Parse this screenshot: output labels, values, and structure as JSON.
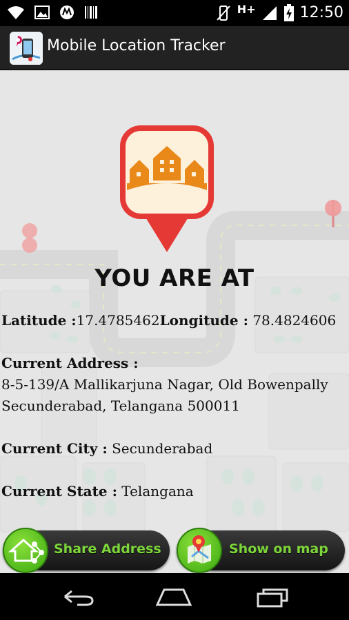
{
  "status_bar": {
    "network_type": "H+",
    "time": "12:50"
  },
  "action_bar": {
    "title": "Mobile Location Tracker"
  },
  "main": {
    "heading": "YOU ARE AT",
    "latitude_label": "Latitude :",
    "latitude_value": "17.4785462",
    "longitude_label": "Longitude :",
    "longitude_value": " 78.4824606",
    "address_label": "Current Address :",
    "address_line1": "8-5-139/A Mallikarjuna Nagar, Old Bowenpally",
    "address_line2": "Secunderabad, Telangana 500011",
    "city_label": "Current City :",
    "city_value": " Secunderabad",
    "state_label": "Current State :",
    "state_value": " Telangana"
  },
  "buttons": {
    "share_address": "Share Address",
    "show_on_map": "Show on map"
  },
  "icons": {
    "location_pin": "house-location-pin-icon",
    "share": "share-house-icon",
    "map": "map-pin-icon"
  },
  "colors": {
    "pin_red": "#e53935",
    "pin_orange": "#e8891a",
    "button_green": "#7dd63a"
  }
}
